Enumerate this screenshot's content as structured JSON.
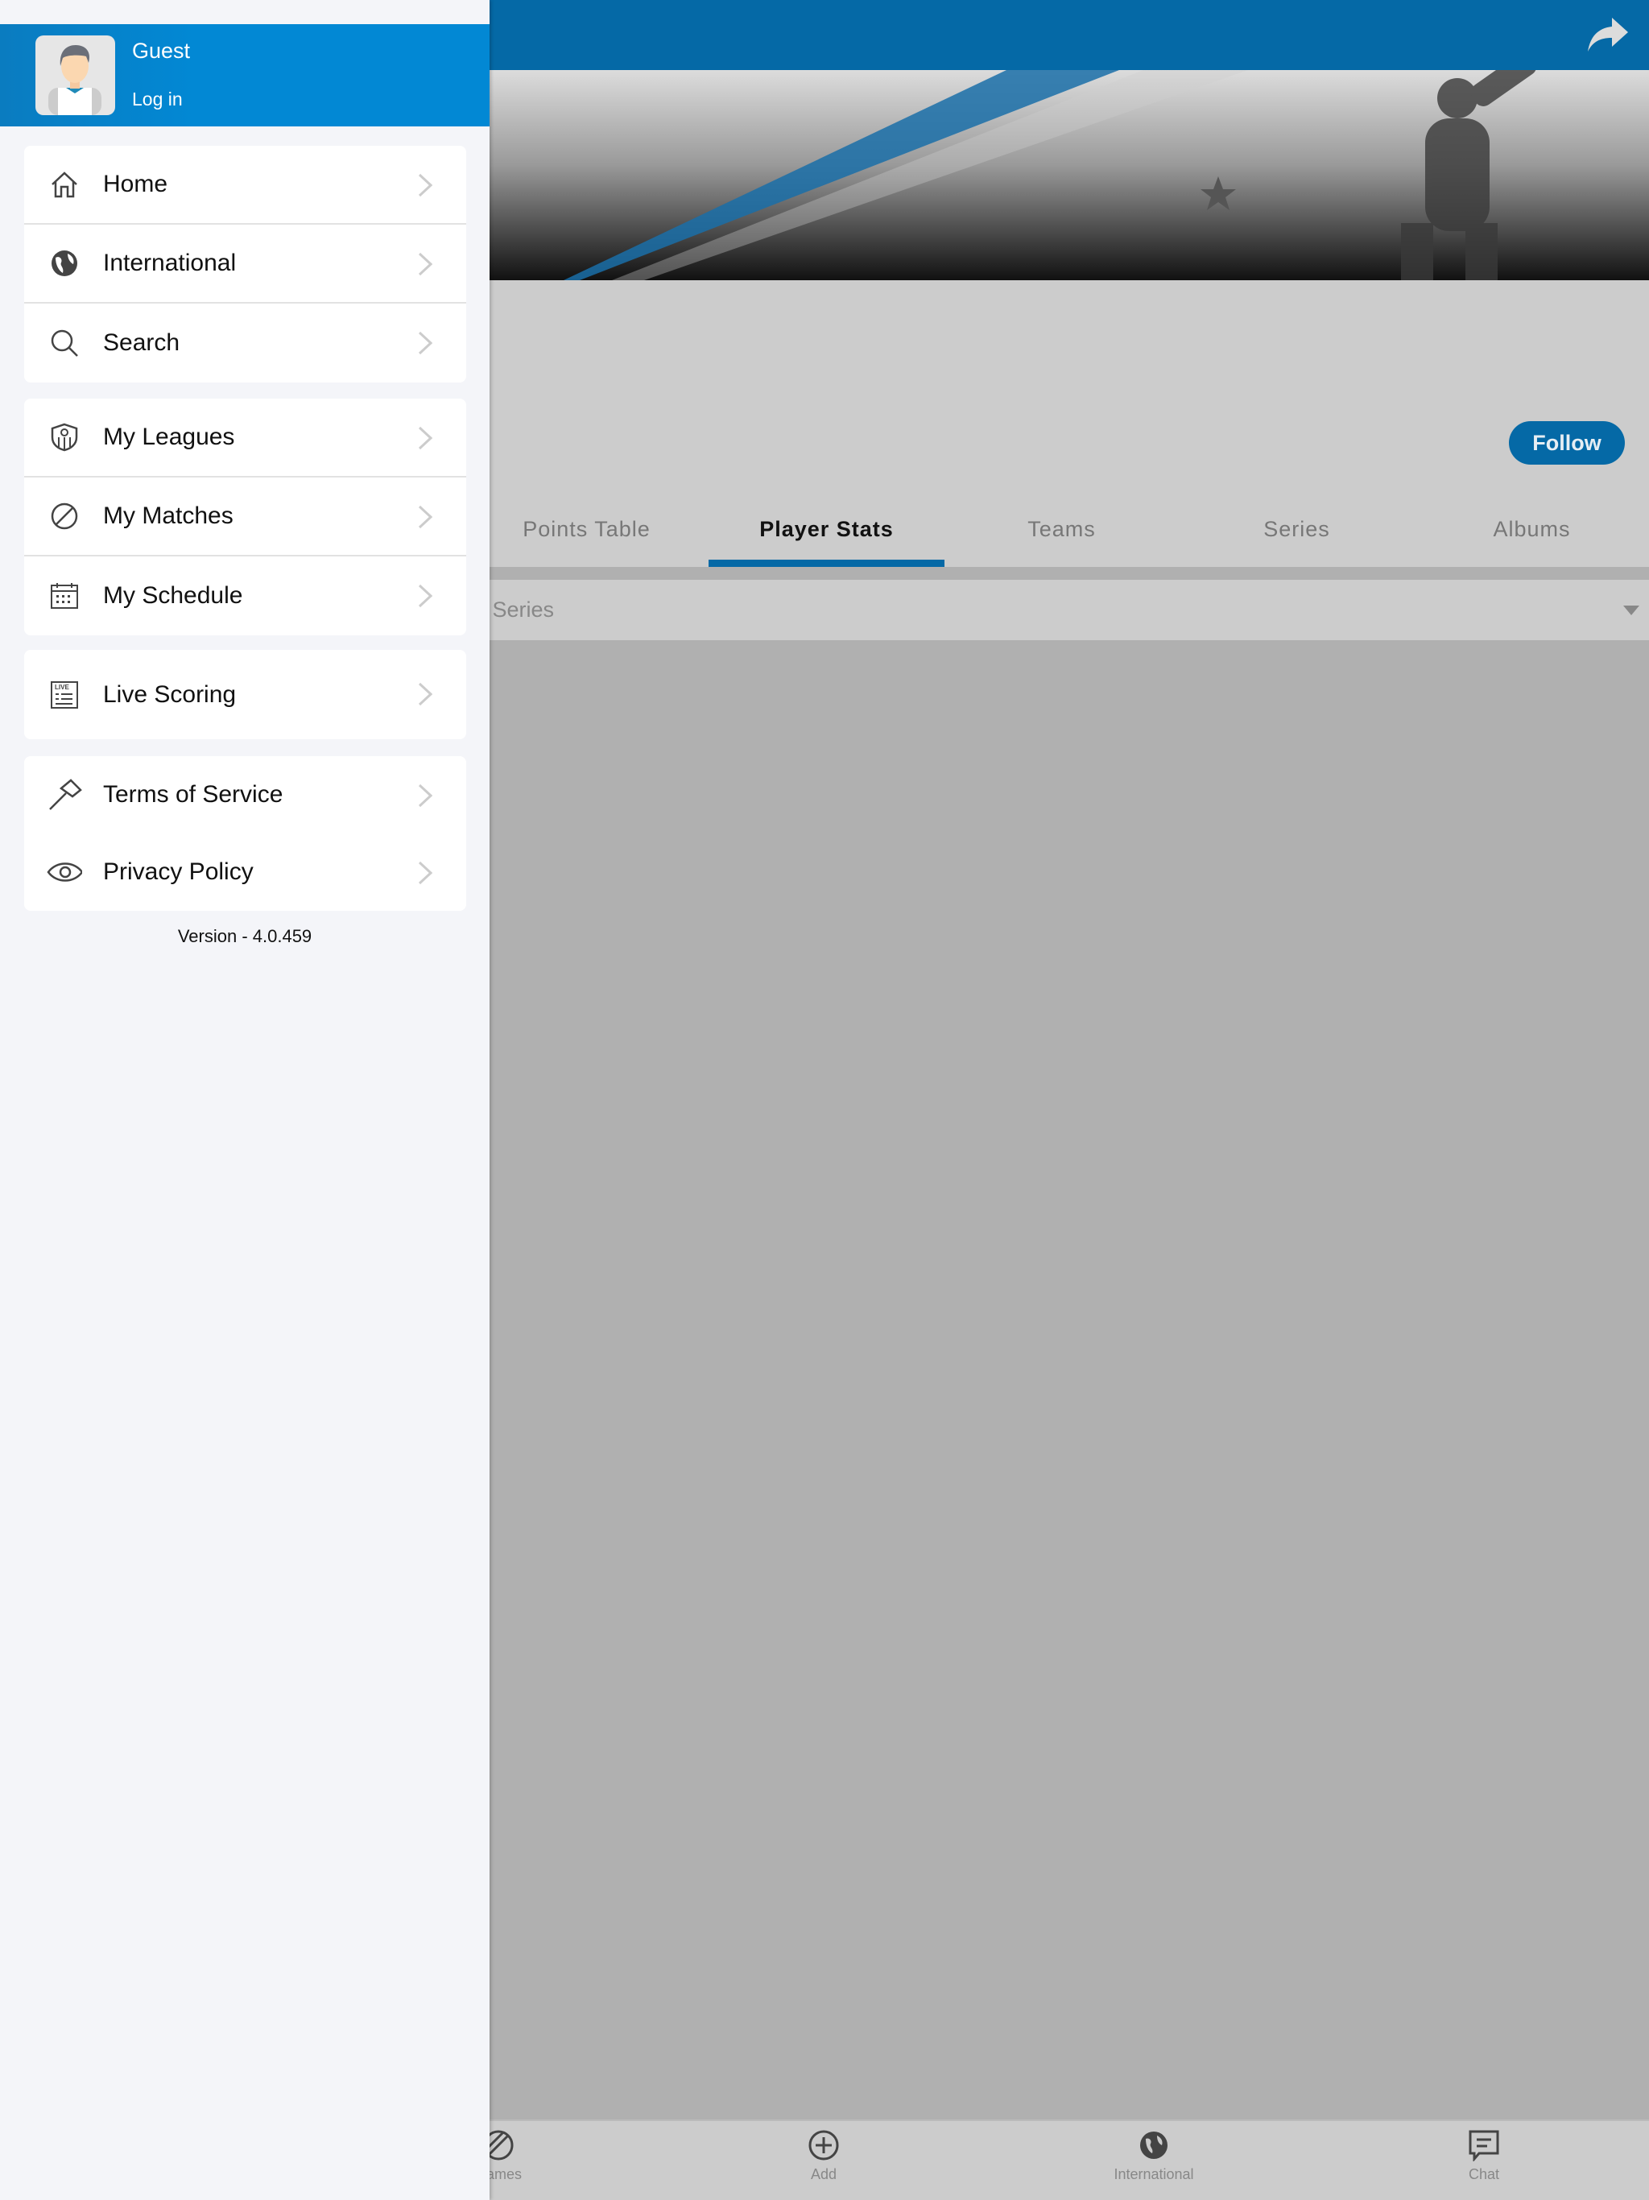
{
  "drawer": {
    "user": {
      "name": "Guest",
      "login": "Log in"
    },
    "groups": [
      [
        {
          "label": "Home",
          "icon": "home-icon"
        },
        {
          "label": "International",
          "icon": "globe-icon"
        },
        {
          "label": "Search",
          "icon": "search-icon"
        }
      ],
      [
        {
          "label": "My Leagues",
          "icon": "shield-icon"
        },
        {
          "label": "My Matches",
          "icon": "cricket-ball-icon"
        },
        {
          "label": "My Schedule",
          "icon": "calendar-icon"
        }
      ],
      [
        {
          "label": "Live Scoring",
          "icon": "live-scoreboard-icon"
        }
      ],
      [
        {
          "label": "Terms of Service",
          "icon": "gavel-icon"
        },
        {
          "label": "Privacy Policy",
          "icon": "eye-icon"
        }
      ]
    ],
    "version": "Version - 4.0.459"
  },
  "main": {
    "follow_label": "Follow",
    "tabs": [
      {
        "label": "Points Table"
      },
      {
        "label": "Player Stats",
        "active": true
      },
      {
        "label": "Teams"
      },
      {
        "label": "Series"
      },
      {
        "label": "Albums"
      }
    ],
    "series_select": "ct Series",
    "bottom_nav": [
      {
        "label": "Games",
        "icon": "games-icon"
      },
      {
        "label": "Add",
        "icon": "add-icon"
      },
      {
        "label": "International",
        "icon": "globe-icon"
      },
      {
        "label": "Chat",
        "icon": "chat-icon"
      }
    ]
  },
  "colors": {
    "accent": "#0569a6",
    "drawer_header": "#0288d4",
    "drawer_bg": "#f4f5f9"
  }
}
